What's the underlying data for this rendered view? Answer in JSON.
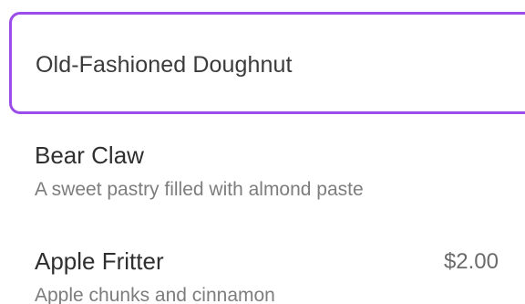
{
  "search": {
    "value": "Old-Fashioned Doughnut"
  },
  "menu": {
    "items": [
      {
        "title": "Bear Claw",
        "description": "A sweet pastry filled with almond paste",
        "price": ""
      },
      {
        "title": "Apple Fritter",
        "description": "Apple chunks and cinnamon",
        "price": "$2.00"
      }
    ]
  },
  "colors": {
    "focus_border": "#9b4dea",
    "title_text": "#2f2f2f",
    "description_text": "#7d7d7d"
  }
}
